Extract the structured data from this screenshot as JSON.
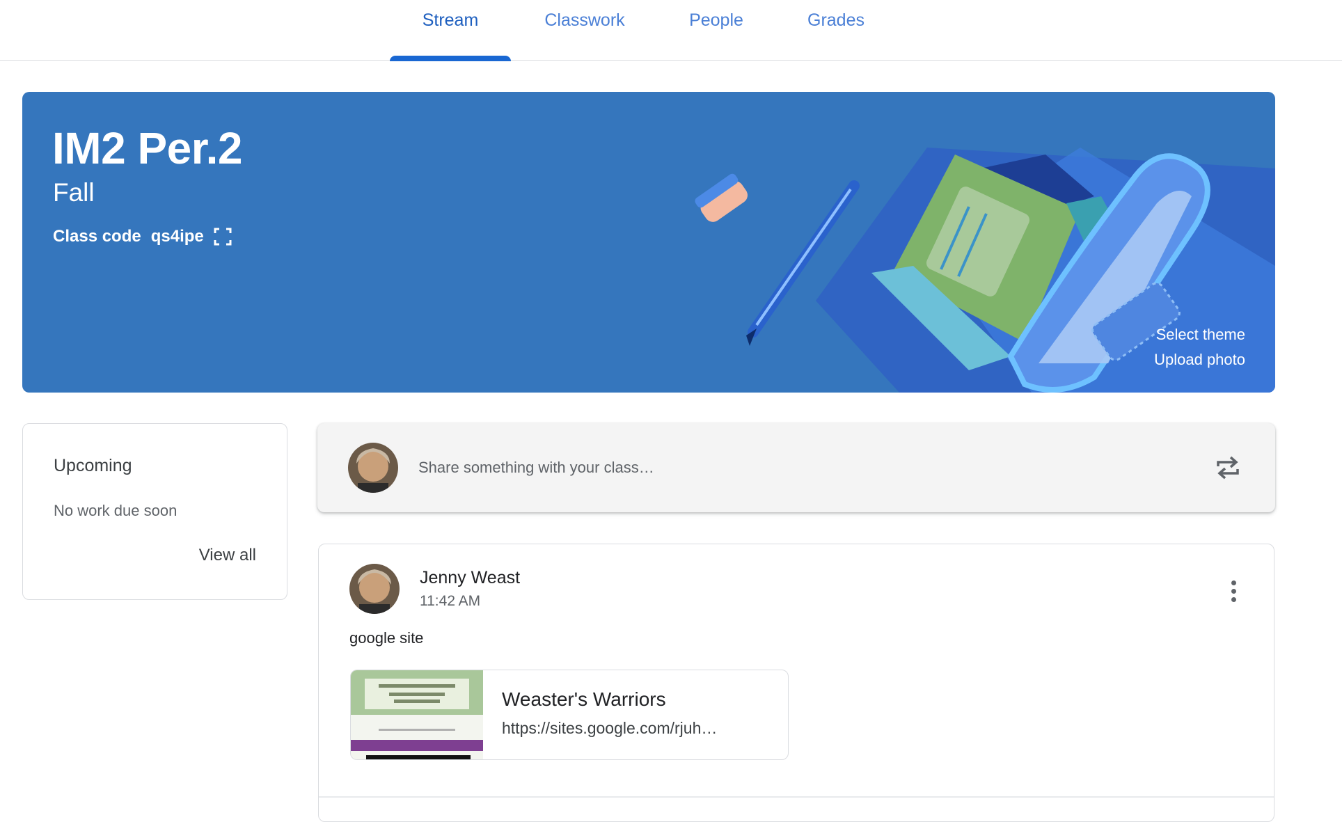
{
  "tabs": [
    {
      "label": "Stream",
      "active": true
    },
    {
      "label": "Classwork",
      "active": false
    },
    {
      "label": "People",
      "active": false
    },
    {
      "label": "Grades",
      "active": false
    }
  ],
  "banner": {
    "title": "IM2 Per.2",
    "section": "Fall",
    "class_code_label": "Class code",
    "class_code": "qs4ipe",
    "select_theme": "Select theme",
    "upload_photo": "Upload photo",
    "color": "#3576bd"
  },
  "upcoming": {
    "title": "Upcoming",
    "empty_text": "No work due soon",
    "view_all": "View all"
  },
  "share": {
    "placeholder": "Share something with your class…"
  },
  "post": {
    "author": "Jenny Weast",
    "time": "11:42 AM",
    "text": "google site",
    "attachment": {
      "title": "Weaster's Warriors",
      "url": "https://sites.google.com/rjuh…"
    }
  },
  "colors": {
    "accent": "#1967d2",
    "tab_text": "#4a7fd6"
  },
  "icons": {
    "expand": "fullscreen-icon",
    "repost": "repost-icon",
    "menu": "more-vert-icon"
  }
}
